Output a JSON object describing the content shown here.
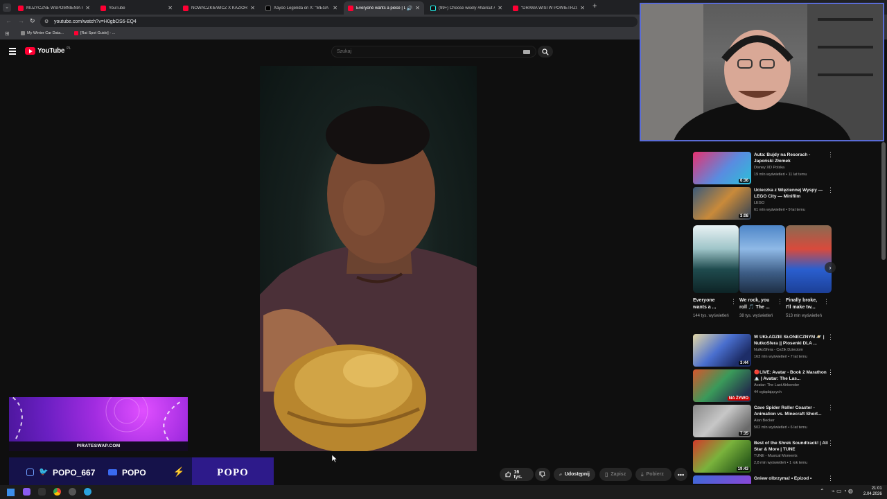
{
  "tabs": [
    {
      "title": "MUZYCZNE WSPOMNIENIA KL",
      "icon": "youtube-icon"
    },
    {
      "title": "YouTube",
      "icon": "youtube-icon"
    },
    {
      "title": "NOWACZKIEWICZ X KAZIOR -",
      "icon": "youtube-icon"
    },
    {
      "title": "Xayoo Legenda on X: \"MEGA",
      "icon": "x-icon"
    },
    {
      "title": "Everyone wants a piece | LE",
      "icon": "youtube-icon",
      "active": true
    },
    {
      "title": "(99+) Choose wisely #haircut #",
      "icon": "tiktok-icon"
    },
    {
      "title": "\"DRAMA WISI W POWIETRZU\"",
      "icon": "youtube-icon"
    }
  ],
  "address": {
    "url": "youtube.com/watch?v=H0gbOS6-EQ4"
  },
  "bookmarks": [
    {
      "label": "My Winter Car Data..."
    },
    {
      "label": "[Rat Spot Guide] - ..."
    }
  ],
  "header": {
    "logo_text": "YouTube",
    "region": "PL",
    "search_placeholder": "Szukaj"
  },
  "actions": {
    "likes": "16 tys.",
    "share": "Udostępnij",
    "save": "Zapisz",
    "download": "Pobierz"
  },
  "recommendations_top": [
    {
      "title": "Auta: Bujdy na Resorach - Japoński Złomek",
      "channel": "Disney XD Polska",
      "meta": "19 mln wyświetleń • 11 lat temu",
      "duration": "6:36"
    },
    {
      "title": "Ucieczka z Więziennej Wyspy — LEGO City — Minifilm",
      "channel": "LEGO",
      "meta": "61 mln wyświetleń • 9 lat temu",
      "duration": "3:08"
    }
  ],
  "shorts": [
    {
      "title": "Everyone wants a ...",
      "views": "144 tys. wyświetleń"
    },
    {
      "title": "We rock, you roll 🎵 The ...",
      "views": "38 tys. wyświetleń"
    },
    {
      "title": "Finally broke, I'll make tw...",
      "views": "513 mln wyświetleń"
    }
  ],
  "recommendations_bottom": [
    {
      "title": "W UKŁADZIE SŁONECZNYM 🪐 | NutkoSfera || Piosenki DLA ...",
      "channel": "NutkoSfera - CeZik Dzieciom",
      "meta": "163 mln wyświetleń • 7 lat temu",
      "duration": "3:44"
    },
    {
      "title": "🔴LIVE: Avatar - Book 2 Marathon 🏔️ | Avatar: The Las...",
      "channel": "Avatar: The Last Airbender",
      "meta": "44 oglądających",
      "duration": "NA ŻYWO"
    },
    {
      "title": "Cave Spider Roller Coaster - Animation vs. Minecraft Short...",
      "channel": "Alan Becker",
      "meta": "502 mln wyświetleń • 6 lat temu",
      "duration": "7:35"
    },
    {
      "title": "Best of the Shrek Soundtrack! | All Star & More | TUNE",
      "channel": "TUNE - Musical Moments",
      "meta": "2,8 mln wyświetleń • 1 rok temu",
      "duration": "19:43"
    },
    {
      "title": "Gniew olbrzyma! • Epizod •",
      "channel": "",
      "meta": "",
      "duration": ""
    }
  ],
  "overlay": {
    "banner_site": "PIRATESWAP.COM",
    "handle_twitter": "POPO_667",
    "handle_youtube": "POPO",
    "name_box": "POPO"
  },
  "clock": {
    "time": "21:01",
    "date": "2.04.2026"
  }
}
